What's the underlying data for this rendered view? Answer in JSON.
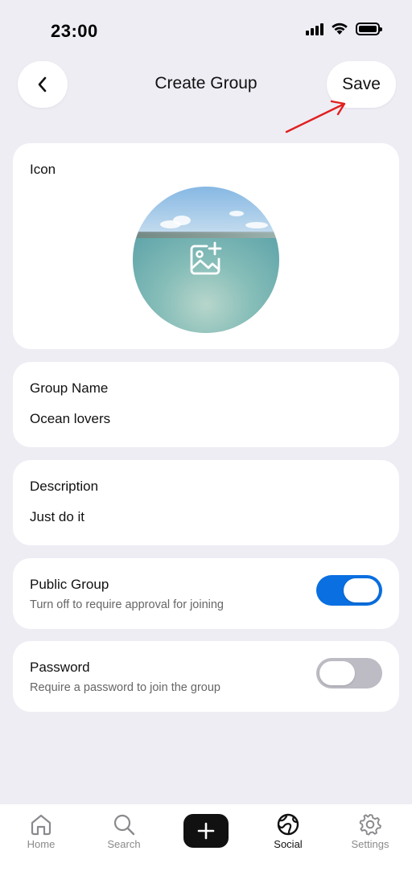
{
  "status_bar": {
    "time": "23:00",
    "icons": [
      "cellular-signal-icon",
      "wifi-icon",
      "battery-icon"
    ]
  },
  "header": {
    "back_icon": "chevron-left-icon",
    "title": "Create Group",
    "save_label": "Save",
    "annotation": "red-arrow-pointing-at-save"
  },
  "icon_card": {
    "label": "Icon",
    "image_icon": "add-photo-icon"
  },
  "group_name": {
    "label": "Group Name",
    "value": "Ocean lovers"
  },
  "description": {
    "label": "Description",
    "value": "Just do it"
  },
  "public_group": {
    "label": "Public Group",
    "subtitle": "Turn off to require approval for joining",
    "enabled": true
  },
  "password": {
    "label": "Password",
    "subtitle": "Require a password to join the group",
    "enabled": false
  },
  "bottom_nav": {
    "items": [
      {
        "label": "Home",
        "icon": "home-icon",
        "active": false
      },
      {
        "label": "Search",
        "icon": "search-icon",
        "active": false
      },
      {
        "label": "",
        "icon": "plus-icon",
        "active": false
      },
      {
        "label": "Social",
        "icon": "globe-icon",
        "active": true
      },
      {
        "label": "Settings",
        "icon": "gear-icon",
        "active": false
      }
    ]
  },
  "colors": {
    "background": "#eeedf4",
    "card": "#ffffff",
    "toggle_on": "#0a6fe0",
    "toggle_off": "#bdbcc4",
    "arrow": "#e02020"
  }
}
